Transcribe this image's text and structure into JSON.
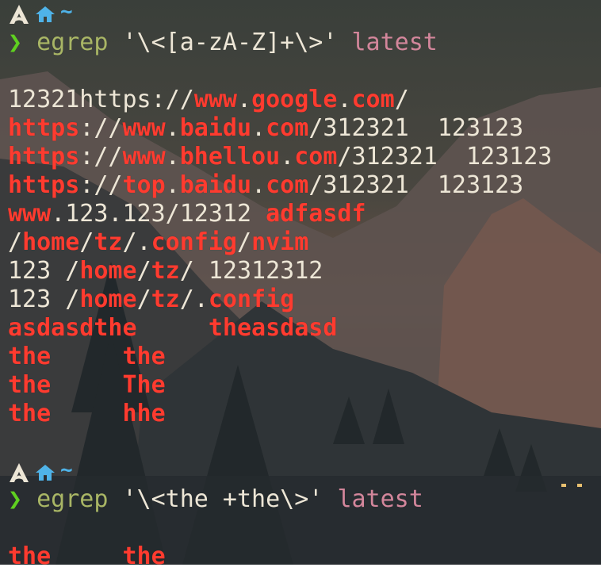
{
  "prompt": {
    "tilde": "~",
    "chevron": "❯"
  },
  "commands": [
    {
      "cmd": "egrep",
      "pattern": "'\\<[a-zA-Z]+\\>'",
      "file": "latest"
    },
    {
      "cmd": "egrep",
      "pattern": "'\\<the +the\\>'",
      "file": "latest"
    }
  ],
  "output1": [
    [
      {
        "t": "12321https://",
        "m": false
      },
      {
        "t": "www",
        "m": true
      },
      {
        "t": ".",
        "m": false
      },
      {
        "t": "google",
        "m": true
      },
      {
        "t": ".",
        "m": false
      },
      {
        "t": "com",
        "m": true
      },
      {
        "t": "/",
        "m": false
      }
    ],
    [
      {
        "t": "https",
        "m": true
      },
      {
        "t": "://",
        "m": false
      },
      {
        "t": "www",
        "m": true
      },
      {
        "t": ".",
        "m": false
      },
      {
        "t": "baidu",
        "m": true
      },
      {
        "t": ".",
        "m": false
      },
      {
        "t": "com",
        "m": true
      },
      {
        "t": "/312321  123123",
        "m": false
      }
    ],
    [
      {
        "t": "https",
        "m": true
      },
      {
        "t": "://",
        "m": false
      },
      {
        "t": "www",
        "m": true
      },
      {
        "t": ".",
        "m": false
      },
      {
        "t": "bhellou",
        "m": true
      },
      {
        "t": ".",
        "m": false
      },
      {
        "t": "com",
        "m": true
      },
      {
        "t": "/312321  123123",
        "m": false
      }
    ],
    [
      {
        "t": "https",
        "m": true
      },
      {
        "t": "://",
        "m": false
      },
      {
        "t": "top",
        "m": true
      },
      {
        "t": ".",
        "m": false
      },
      {
        "t": "baidu",
        "m": true
      },
      {
        "t": ".",
        "m": false
      },
      {
        "t": "com",
        "m": true
      },
      {
        "t": "/312321  123123",
        "m": false
      }
    ],
    [
      {
        "t": "www",
        "m": true
      },
      {
        "t": ".123.123/12312 ",
        "m": false
      },
      {
        "t": "adfasdf",
        "m": true
      }
    ],
    [
      {
        "t": "/",
        "m": false
      },
      {
        "t": "home",
        "m": true
      },
      {
        "t": "/",
        "m": false
      },
      {
        "t": "tz",
        "m": true
      },
      {
        "t": "/.",
        "m": false
      },
      {
        "t": "config",
        "m": true
      },
      {
        "t": "/",
        "m": false
      },
      {
        "t": "nvim",
        "m": true
      }
    ],
    [
      {
        "t": "123 /",
        "m": false
      },
      {
        "t": "home",
        "m": true
      },
      {
        "t": "/",
        "m": false
      },
      {
        "t": "tz",
        "m": true
      },
      {
        "t": "/ 12312312",
        "m": false
      }
    ],
    [
      {
        "t": "123 /",
        "m": false
      },
      {
        "t": "home",
        "m": true
      },
      {
        "t": "/",
        "m": false
      },
      {
        "t": "tz",
        "m": true
      },
      {
        "t": "/.",
        "m": false
      },
      {
        "t": "config",
        "m": true
      }
    ],
    [
      {
        "t": "asdasdthe",
        "m": true
      },
      {
        "t": "     ",
        "m": false
      },
      {
        "t": "theasdasd",
        "m": true
      }
    ],
    [
      {
        "t": "the",
        "m": true
      },
      {
        "t": "     ",
        "m": false
      },
      {
        "t": "the",
        "m": true
      }
    ],
    [
      {
        "t": "the",
        "m": true
      },
      {
        "t": "     ",
        "m": false
      },
      {
        "t": "The",
        "m": true
      }
    ],
    [
      {
        "t": "the",
        "m": true
      },
      {
        "t": "     ",
        "m": false
      },
      {
        "t": "hhe",
        "m": true
      }
    ]
  ],
  "output2": [
    [
      {
        "t": "the",
        "m": true
      },
      {
        "t": "     ",
        "m": false
      },
      {
        "t": "the",
        "m": true
      }
    ]
  ],
  "colors": {
    "match": "#ff3b2f",
    "plain": "#ede6d6",
    "command": "#a9b665",
    "argument": "#d3869b",
    "chevron": "#5fd020",
    "icon": "#4fb3e8"
  }
}
